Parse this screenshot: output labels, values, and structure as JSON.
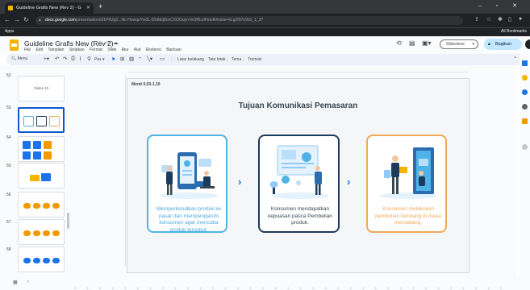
{
  "browser": {
    "tab_title": "Guideline Grafis New (Rev 2) - G",
    "new_tab": "+",
    "window_controls": "–  ▫  ✕",
    "url_host": "docs.google.com",
    "url_path": "/presentation/d/1PR2g2...Nc-HowqsYw3L-f2h8dq8ocCr03Ouyn-fxOfRcdFt/edit#slide=id.g2f07e9b1_1_37",
    "bookmarks_apps": "Apps",
    "bookmarks_all": "All Bookmarks"
  },
  "slides": {
    "doc_title": "Guideline Grafis New (Rev 2)",
    "menus": [
      "File",
      "Edit",
      "Tampilan",
      "Sisipkan",
      "Format",
      "Slide",
      "Atur",
      "Alat",
      "Ekstensi",
      "Bantuan"
    ],
    "slideshow_label": "Slideshow",
    "share_label": "Bagikan",
    "toolbar": {
      "menus_search": "Menu",
      "zoom_label": "Pas",
      "background": "Latar belakang",
      "layout": "Tata letak",
      "theme": "Tema",
      "transition": "Transisi"
    }
  },
  "filmstrip": {
    "slides": [
      {
        "num": "52",
        "label": "Slides 10"
      },
      {
        "num": "53"
      },
      {
        "num": "54"
      },
      {
        "num": "55"
      },
      {
        "num": "56"
      },
      {
        "num": "57"
      },
      {
        "num": "58"
      }
    ]
  },
  "slide": {
    "tag": "Menit 0.03-1.10",
    "title": "Tujuan Komunikasi Pemasaran",
    "cards": [
      {
        "text": "Memperkenalkan produk ke pasar dan mempengaruhi konsumen agar mencoba produk tersebut."
      },
      {
        "text": "Konsumen mendapatkan kepuasan pasca Pembelian produk."
      },
      {
        "text": "Konsumen melakukan pembelian berulang di masa mendatang."
      }
    ],
    "arrow": "›"
  },
  "colors": {
    "card1_border": "#4fb3e8",
    "card2_border": "#1c3a5c",
    "card3_border": "#f0a85a",
    "accent_blue": "#1a73e8",
    "share_bg": "#c2e7ff"
  }
}
